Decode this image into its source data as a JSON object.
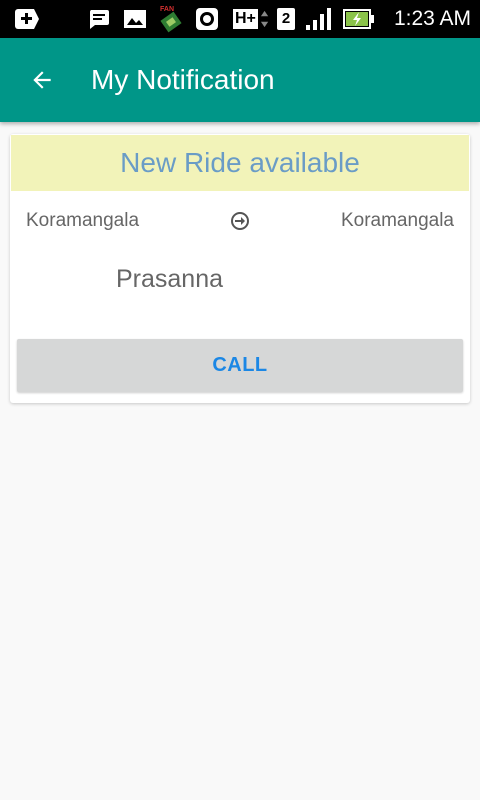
{
  "status_bar": {
    "time": "1:23 AM",
    "network_type": "H+",
    "sim_slot": "2",
    "icons": [
      "add-notification-icon",
      "message-icon",
      "image-icon",
      "satellite-app-icon",
      "record-icon",
      "network-type-icon",
      "sim-icon",
      "signal-icon",
      "battery-charging-icon"
    ]
  },
  "app_bar": {
    "title": "My Notification",
    "back_icon": "arrow-back-icon",
    "color": "#009688"
  },
  "card": {
    "header": "New Ride available",
    "header_bg": "#f2f3b9",
    "from": "Koramangala",
    "to": "Koramangala",
    "route_icon": "arrow-circle-right-icon",
    "passenger_name": "Prasanna",
    "call_label": "CALL",
    "call_color": "#1b87e5"
  }
}
